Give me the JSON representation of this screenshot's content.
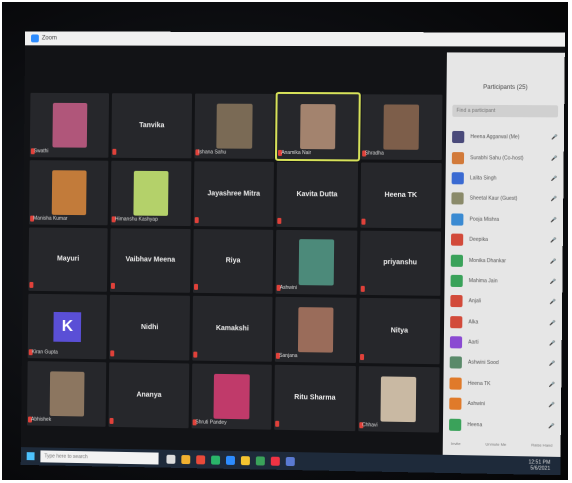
{
  "window": {
    "title": "Zoom"
  },
  "gallery": {
    "tiles": [
      {
        "name": "Swathi",
        "kind": "video",
        "color": "#b0567a"
      },
      {
        "name": "Tanvika",
        "kind": "label",
        "color": ""
      },
      {
        "name": "Ishana Sahu",
        "kind": "video",
        "color": "#7a6a55"
      },
      {
        "name": "Anamika Nair",
        "kind": "video",
        "color": "#a3836e",
        "active": true
      },
      {
        "name": "Shradha",
        "kind": "video",
        "color": "#7d5e4a"
      },
      {
        "name": "Manisha Kumar",
        "kind": "video",
        "color": "#c27b3a"
      },
      {
        "name": "Himanshu Kashyap",
        "kind": "video",
        "color": "#b4d16a"
      },
      {
        "name": "Jayashree Mitra",
        "kind": "label",
        "color": ""
      },
      {
        "name": "Kavita Dutta",
        "kind": "label",
        "color": ""
      },
      {
        "name": "Heena TK",
        "kind": "label",
        "color": ""
      },
      {
        "name": "Mayuri",
        "kind": "label",
        "color": ""
      },
      {
        "name": "Vaibhav Meena",
        "kind": "label",
        "color": ""
      },
      {
        "name": "Riya",
        "kind": "label",
        "color": ""
      },
      {
        "name": "Ashwini",
        "kind": "video",
        "color": "#4c8a7a"
      },
      {
        "name": "priyanshu",
        "kind": "label",
        "color": ""
      },
      {
        "name": "Kiran Gupta",
        "kind": "initial",
        "initial": "K"
      },
      {
        "name": "Nidhi",
        "kind": "label",
        "color": ""
      },
      {
        "name": "Kamakshi",
        "kind": "label",
        "color": ""
      },
      {
        "name": "Sanjana",
        "kind": "video",
        "color": "#9a6c5a"
      },
      {
        "name": "Nitya",
        "kind": "label",
        "color": ""
      },
      {
        "name": "Abhishek",
        "kind": "video",
        "color": "#8c7660"
      },
      {
        "name": "Ananya",
        "kind": "label",
        "color": ""
      },
      {
        "name": "Shruti Pandey",
        "kind": "video",
        "color": "#c03a6a"
      },
      {
        "name": "Ritu Sharma",
        "kind": "label",
        "color": ""
      },
      {
        "name": "Chhavi",
        "kind": "video",
        "color": "#c9b9a3"
      }
    ]
  },
  "panel": {
    "title": "Participants (25)",
    "search_placeholder": "Find a participant",
    "participants": [
      {
        "name": "Heena Aggarwal (Me)",
        "color": "#4a4a7a"
      },
      {
        "name": "Surabhi Sahu (Co-host)",
        "color": "#d27a3a"
      },
      {
        "name": "Lalita Singh",
        "color": "#3a6ad2"
      },
      {
        "name": "Sheetal Kaur (Guest)",
        "color": "#8a8a6a"
      },
      {
        "name": "Pooja Mishra",
        "color": "#3a8ad2"
      },
      {
        "name": "Deepika",
        "color": "#d24a3a"
      },
      {
        "name": "Monika Dhankar",
        "color": "#3aa25a"
      },
      {
        "name": "Mahima Jain",
        "color": "#3aa25a"
      },
      {
        "name": "Anjali",
        "color": "#d24a3a"
      },
      {
        "name": "Alka",
        "color": "#d24a3a"
      },
      {
        "name": "Aarti",
        "color": "#8a4ad2"
      },
      {
        "name": "Ashwini Sood",
        "color": "#5a8a6a"
      },
      {
        "name": "Heena TK",
        "color": "#e07a2a"
      },
      {
        "name": "Ashwini",
        "color": "#e07a2a"
      },
      {
        "name": "Heena",
        "color": "#3aa25a"
      }
    ],
    "footer": [
      "Invite",
      "Unmute Me",
      "Raise Hand"
    ]
  },
  "taskbar": {
    "search_placeholder": "Type here to search",
    "time": "12:51 PM",
    "date": "5/6/2021"
  }
}
